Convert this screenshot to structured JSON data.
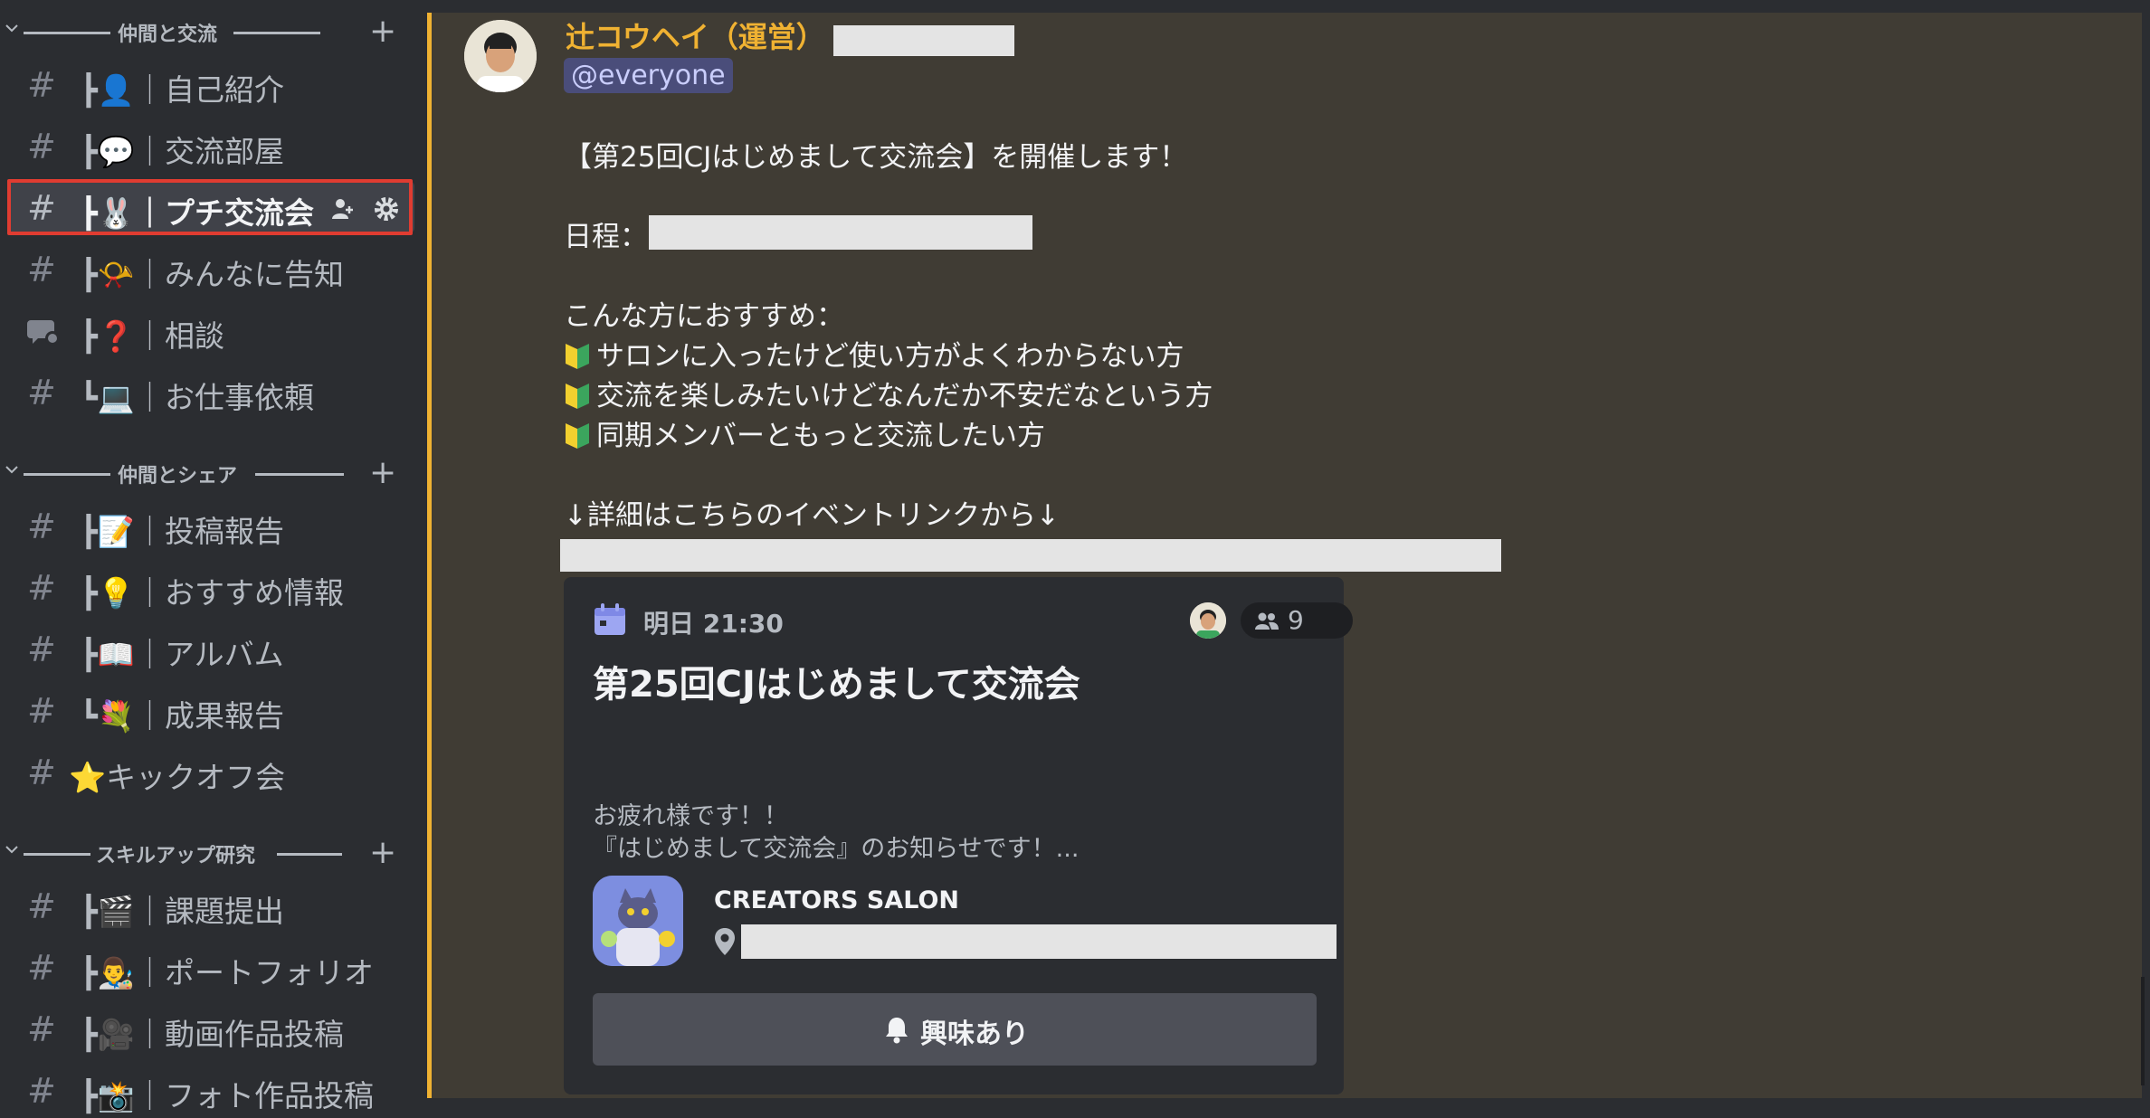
{
  "sidebar": {
    "categories": [
      {
        "label": "仲間と交流",
        "add_label": "+"
      },
      {
        "label": "仲間とシェア",
        "add_label": "+"
      },
      {
        "label": "スキルアップ研究",
        "add_label": "+"
      }
    ],
    "channels": [
      {
        "label": "┣👤｜自己紹介"
      },
      {
        "label": "┣💬｜交流部屋"
      },
      {
        "label": "┣🐰｜プチ交流会"
      },
      {
        "label": "┣📯｜みんなに告知"
      },
      {
        "label": "┣❓｜相談"
      },
      {
        "label": "┗💻｜お仕事依頼"
      },
      {
        "label": "┣📝｜投稿報告"
      },
      {
        "label": "┣💡｜おすすめ情報"
      },
      {
        "label": "┣📖｜アルバム"
      },
      {
        "label": "┗💐｜成果報告"
      },
      {
        "label": "⭐キックオフ会"
      },
      {
        "label": "┣🎬｜課題提出"
      },
      {
        "label": "┣👨‍🎨｜ポートフォリオ"
      },
      {
        "label": "┣🎥｜動画作品投稿"
      },
      {
        "label": "┣📸｜フォト作品投稿"
      }
    ],
    "hash_symbol": "#"
  },
  "message": {
    "author": "辻コウヘイ（運営）",
    "mention": "@everyone",
    "lines": [
      "【第25回CJはじめまして交流会】を開催します！",
      "日程：",
      "こんな方におすすめ：",
      "サロンに入ったけど使い方がよくわからない方",
      "交流を楽しみたいけどなんだか不安だなという方",
      "同期メンバーともっと交流したい方",
      "↓詳細はこちらのイベントリンクから↓"
    ]
  },
  "event": {
    "time": "明日 21:30",
    "attendee_count": "9",
    "title": "第25回CJはじめまして交流会",
    "description_lines": [
      "お疲れ様です！！",
      "『はじめまして交流会』のお知らせです！..."
    ],
    "server_name": "CREATORS SALON",
    "interest_label": "興味あり"
  },
  "colors": {
    "accent": "#f0b232",
    "highlight": "#e03c31",
    "bullet_green": "#3ba55d",
    "bullet_yellow": "#f2d02f"
  }
}
